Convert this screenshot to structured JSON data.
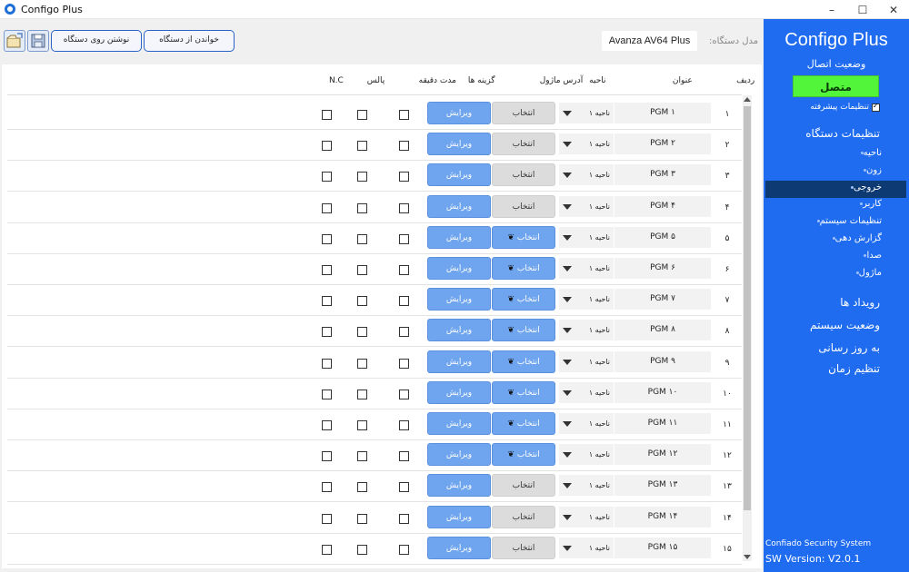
{
  "window": {
    "title": "Configo Plus",
    "controls": [
      "–",
      "☐",
      "✕"
    ]
  },
  "toolbar": {
    "read_label": "خواندن از دستگاه",
    "write_label": "نوشتن روی دستگاه",
    "model_label": "مدل دستگاه:",
    "model_value": "Avanza AV64 Plus"
  },
  "sidebar": {
    "brand": "Configo Plus",
    "connection_label": "وضعیت اتصال",
    "connection_status": "متصل",
    "advanced_label": "تنظیمات پیشرفته",
    "device_settings_label": "تنظیمات دستگاه",
    "sub_items": [
      {
        "label": "ناحیه",
        "active": false
      },
      {
        "label": "زون",
        "active": false
      },
      {
        "label": "خروجی",
        "active": true
      },
      {
        "label": "کاربر",
        "active": false
      },
      {
        "label": "تنظیمات سیستم",
        "active": false
      },
      {
        "label": "گزارش دهی",
        "active": false
      },
      {
        "label": "صدا",
        "active": false
      },
      {
        "label": "ماژول",
        "active": false
      }
    ],
    "main_items": [
      "رویداد ها",
      "وضعیت سیستم",
      "به روز رسانی",
      "تنظیم زمان"
    ],
    "company": "Confiado Security System",
    "version": "SW Version: V2.0.1"
  },
  "table": {
    "headers": {
      "index": "ردیف",
      "title": "عنوان",
      "zone": "ناحیه",
      "module_address": "آدرس ماژول",
      "options": "گزینه ها",
      "duration": "مدت دقیقه",
      "pulse": "پالس",
      "nc": "N.C"
    },
    "select_label": "انتخاب",
    "edit_label": "ویرایش",
    "rows": [
      {
        "index": "۱",
        "title": "PGM ۱",
        "zone": "ناحیه ۱",
        "module_set": false
      },
      {
        "index": "۲",
        "title": "PGM ۲",
        "zone": "ناحیه ۱",
        "module_set": false
      },
      {
        "index": "۳",
        "title": "PGM ۳",
        "zone": "ناحیه ۱",
        "module_set": false
      },
      {
        "index": "۴",
        "title": "PGM ۴",
        "zone": "ناحیه ۱",
        "module_set": false
      },
      {
        "index": "۵",
        "title": "PGM ۵",
        "zone": "ناحیه ۱",
        "module_set": true
      },
      {
        "index": "۶",
        "title": "PGM ۶",
        "zone": "ناحیه ۱",
        "module_set": true
      },
      {
        "index": "۷",
        "title": "PGM ۷",
        "zone": "ناحیه ۱",
        "module_set": true
      },
      {
        "index": "۸",
        "title": "PGM ۸",
        "zone": "ناحیه ۱",
        "module_set": true
      },
      {
        "index": "۹",
        "title": "PGM ۹",
        "zone": "ناحیه ۱",
        "module_set": true
      },
      {
        "index": "۱۰",
        "title": "PGM ۱۰",
        "zone": "ناحیه ۱",
        "module_set": true
      },
      {
        "index": "۱۱",
        "title": "PGM ۱۱",
        "zone": "ناحیه ۱",
        "module_set": true
      },
      {
        "index": "۱۲",
        "title": "PGM ۱۲",
        "zone": "ناحیه ۱",
        "module_set": true
      },
      {
        "index": "۱۳",
        "title": "PGM ۱۳",
        "zone": "ناحیه ۱",
        "module_set": false
      },
      {
        "index": "۱۴",
        "title": "PGM ۱۴",
        "zone": "ناحیه ۱",
        "module_set": false
      },
      {
        "index": "۱۵",
        "title": "PGM ۱۵",
        "zone": "ناحیه ۱",
        "module_set": false
      }
    ]
  },
  "icons": {
    "open": "folder-open-icon",
    "save": "floppy-disk-icon",
    "module": "leaf-icon",
    "dropdown": "caret-down-icon"
  },
  "colors": {
    "sidebar_bg": "#1f6cf0",
    "connected_green": "#53f53b",
    "active_nav": "#0d3a72",
    "button_blue": "#6fa4ee"
  }
}
